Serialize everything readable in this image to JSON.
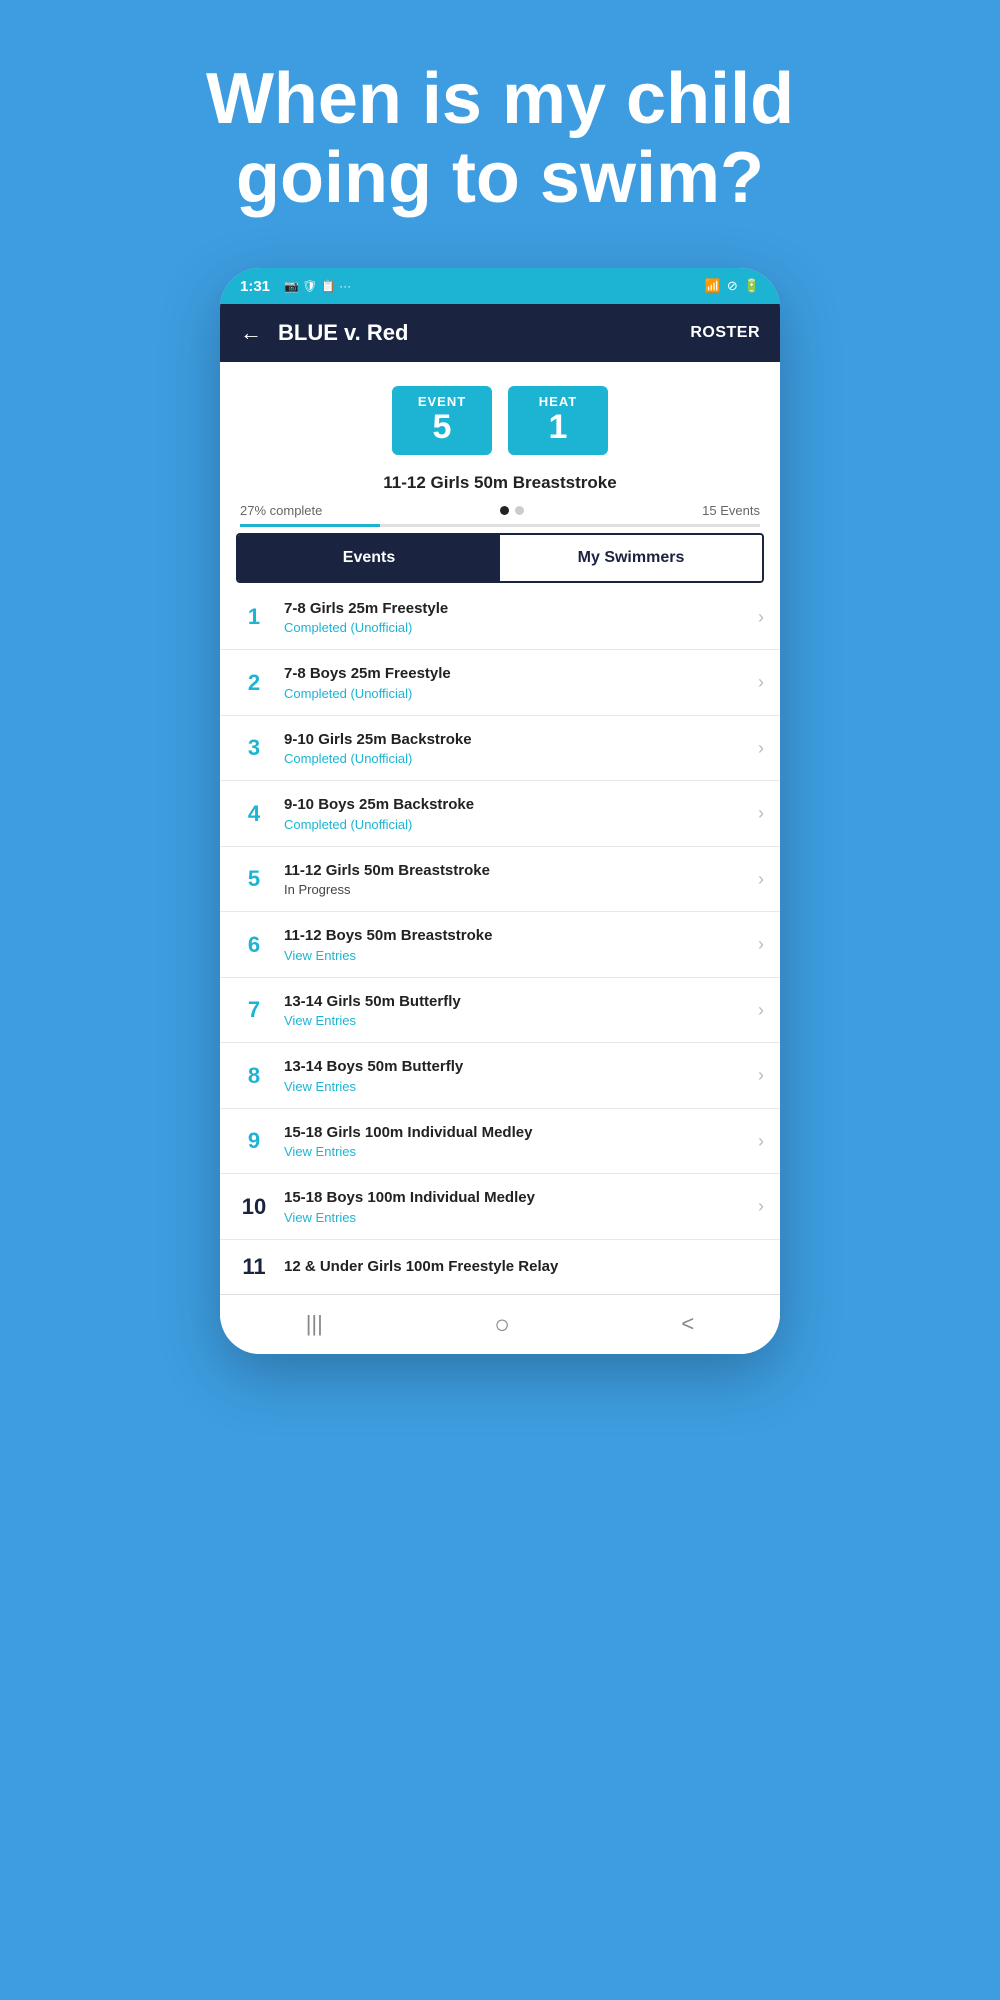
{
  "hero": {
    "text_line1": "When is my child",
    "text_line2": "going to swim?"
  },
  "phone": {
    "status_bar": {
      "time": "1:31",
      "left_icons": "📷 🛡 📋 ···",
      "right_icons": "WiFi ⊘ 🔋"
    },
    "nav": {
      "back_icon": "←",
      "title": "BLUE v. Red",
      "roster_label": "ROSTER"
    },
    "event_badge": {
      "label": "EVENT",
      "number": "5"
    },
    "heat_badge": {
      "label": "HEAT",
      "number": "1"
    },
    "event_subtitle": "11-12 Girls 50m Breaststroke",
    "progress": {
      "percent": "27% complete",
      "total": "15 Events"
    },
    "tabs": {
      "events_label": "Events",
      "my_swimmers_label": "My Swimmers"
    },
    "events": [
      {
        "number": "1",
        "name": "7-8 Girls 25m Freestyle",
        "status": "Completed (Unofficial)",
        "status_type": "completed"
      },
      {
        "number": "2",
        "name": "7-8 Boys 25m Freestyle",
        "status": "Completed (Unofficial)",
        "status_type": "completed"
      },
      {
        "number": "3",
        "name": "9-10 Girls 25m Backstroke",
        "status": "Completed (Unofficial)",
        "status_type": "completed"
      },
      {
        "number": "4",
        "name": "9-10 Boys 25m Backstroke",
        "status": "Completed (Unofficial)",
        "status_type": "completed"
      },
      {
        "number": "5",
        "name": "11-12 Girls 50m Breaststroke",
        "status": "In Progress",
        "status_type": "in-progress"
      },
      {
        "number": "6",
        "name": "11-12 Boys 50m Breaststroke",
        "status": "View Entries",
        "status_type": "view"
      },
      {
        "number": "7",
        "name": "13-14 Girls 50m Butterfly",
        "status": "View Entries",
        "status_type": "view"
      },
      {
        "number": "8",
        "name": "13-14 Boys 50m Butterfly",
        "status": "View Entries",
        "status_type": "view"
      },
      {
        "number": "9",
        "name": "15-18 Girls 100m Individual Medley",
        "status": "View Entries",
        "status_type": "view"
      },
      {
        "number": "10",
        "name": "15-18 Boys 100m Individual Medley",
        "status": "View Entries",
        "status_type": "view"
      },
      {
        "number": "11",
        "name": "12 & Under Girls 100m Freestyle Relay",
        "status": "",
        "status_type": "partial"
      }
    ],
    "bottom_nav": {
      "menu_icon": "|||",
      "home_icon": "○",
      "back_icon": "<"
    }
  }
}
